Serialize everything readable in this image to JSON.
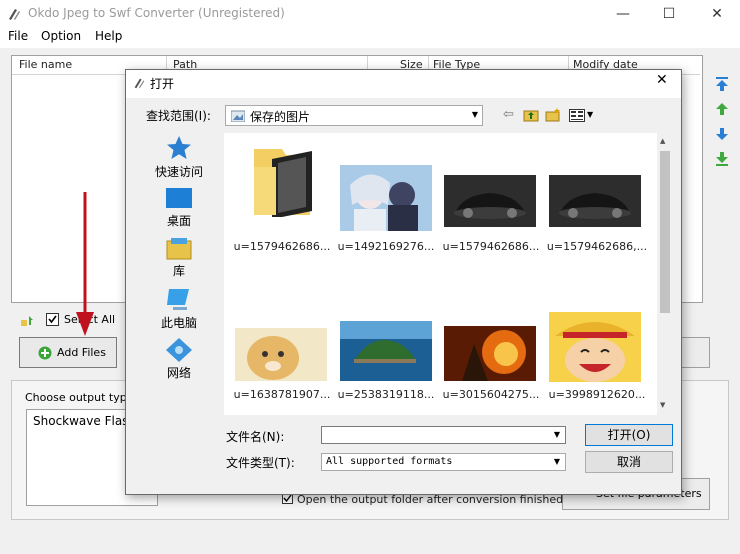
{
  "window": {
    "title": "Okdo Jpeg to Swf Converter (Unregistered)",
    "minimize": "—",
    "maximize": "☐",
    "close": "✕"
  },
  "menu": [
    "File",
    "Option",
    "Help"
  ],
  "file_list": {
    "columns": [
      "File name",
      "Path",
      "Size",
      "File Type",
      "Modify date"
    ]
  },
  "select_all_label": "Select All",
  "add_files_label": "Add Files",
  "output": {
    "label": "Choose output type:",
    "selected": "Shockwave Flash",
    "open_folder_label": "Open the output folder after conversion finished",
    "settings_label": "Set file parameters"
  },
  "dialog": {
    "title": "打开",
    "lookin_label": "查找范围(I):",
    "lookin_value": "保存的图片",
    "places": [
      {
        "label": "快速访问",
        "icon": "star-icon"
      },
      {
        "label": "桌面",
        "icon": "desktop-icon"
      },
      {
        "label": "库",
        "icon": "library-icon"
      },
      {
        "label": "此电脑",
        "icon": "computer-icon"
      },
      {
        "label": "网络",
        "icon": "network-icon"
      }
    ],
    "files": [
      {
        "label": "u=1579462686...",
        "kind": "folder"
      },
      {
        "label": "u=1492169276...",
        "kind": "anime"
      },
      {
        "label": "u=1579462686...",
        "kind": "car"
      },
      {
        "label": "u=1579462686,...",
        "kind": "car"
      },
      {
        "label": "u=1638781907...",
        "kind": "dog"
      },
      {
        "label": "u=2538319118...",
        "kind": "island"
      },
      {
        "label": "u=3015604275...",
        "kind": "fire"
      },
      {
        "label": "u=3998912620...",
        "kind": "luffy"
      }
    ],
    "filename_label": "文件名(N):",
    "filename_value": "",
    "filetype_label": "文件类型(T):",
    "filetype_value": "All supported formats",
    "open_label": "打开(O)",
    "cancel_label": "取消"
  }
}
